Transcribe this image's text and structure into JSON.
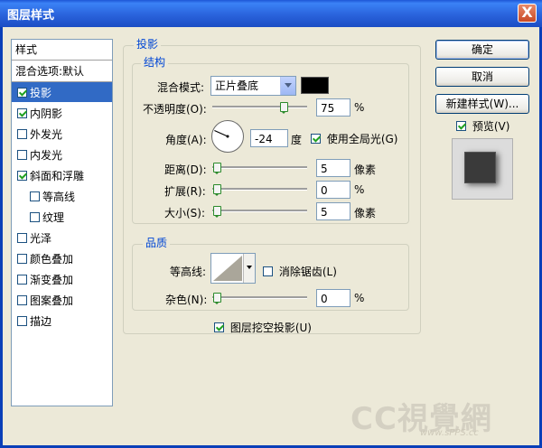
{
  "window": {
    "title": "图层样式",
    "close_glyph": "X"
  },
  "sidebar": {
    "header": "样式",
    "blend": "混合选项:默认",
    "items": [
      {
        "label": "投影",
        "checked": true,
        "selected": true
      },
      {
        "label": "内阴影",
        "checked": true
      },
      {
        "label": "外发光",
        "checked": false
      },
      {
        "label": "内发光",
        "checked": false
      },
      {
        "label": "斜面和浮雕",
        "checked": true
      },
      {
        "label": "等高线",
        "checked": false,
        "indent": true
      },
      {
        "label": "纹理",
        "checked": false,
        "indent": true
      },
      {
        "label": "光泽",
        "checked": false
      },
      {
        "label": "颜色叠加",
        "checked": false
      },
      {
        "label": "渐变叠加",
        "checked": false
      },
      {
        "label": "图案叠加",
        "checked": false
      },
      {
        "label": "描边",
        "checked": false
      }
    ]
  },
  "panel": {
    "title": "投影",
    "structure": {
      "title": "结构",
      "blend_mode_label": "混合模式:",
      "blend_mode_value": "正片叠底",
      "color": "#000000",
      "opacity_label": "不透明度(O):",
      "opacity_value": "75",
      "opacity_unit": "%",
      "opacity_level": 0.75,
      "angle_label": "角度(A):",
      "angle_value": "-24",
      "angle_unit": "度",
      "global_light_label": "使用全局光(G)",
      "global_light_checked": true,
      "distance_label": "距离(D):",
      "distance_value": "5",
      "distance_unit": "像素",
      "spread_label": "扩展(R):",
      "spread_value": "0",
      "spread_unit": "%",
      "size_label": "大小(S):",
      "size_value": "5",
      "size_unit": "像素"
    },
    "quality": {
      "title": "品质",
      "contour_label": "等高线:",
      "antialias_label": "消除锯齿(L)",
      "antialias_checked": false,
      "noise_label": "杂色(N):",
      "noise_value": "0",
      "noise_unit": "%"
    },
    "knockout_label": "图层挖空投影(U)",
    "knockout_checked": true
  },
  "buttons": {
    "ok": "确定",
    "cancel": "取消",
    "new_style": "新建样式(W)...",
    "preview_label": "预览(V)",
    "preview_checked": true
  },
  "watermark": {
    "text": "CC視覺網",
    "url": "www.sPPS.cc"
  }
}
